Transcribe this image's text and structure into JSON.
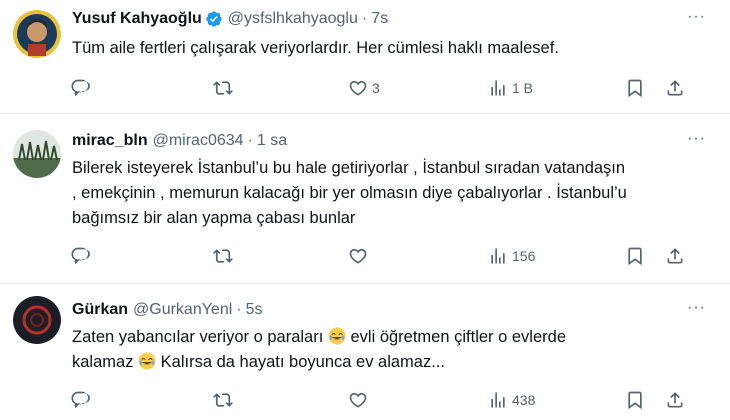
{
  "tweets": [
    {
      "name": "Yusuf Kahyaoğlu",
      "verified": true,
      "handle": "@ysfslhkahyaoglu",
      "time": "7s",
      "lines": [
        "Tüm aile fertleri çalışarak veriyorlardır. Her cümlesi haklı maalesef."
      ],
      "likes": "3",
      "views": "1 B"
    },
    {
      "name": "mirac_bln",
      "verified": false,
      "handle": "@mirac0634",
      "time": "1 sa",
      "lines": [
        "Bilerek isteyerek İstanbul’u bu hale getiriyorlar , İstanbul sıradan vatandaşın",
        ", emekçinin , memurun kalacağı bir yer olmasın diye çabalıyorlar . İstanbul’u",
        "bağımsız bir alan yapma çabası bunlar"
      ],
      "likes": "",
      "views": "156"
    },
    {
      "name": "Gürkan",
      "verified": false,
      "handle": "@GurkanYenl",
      "time": "5s",
      "line1_a": "Zaten yabancılar veriyor o paraları",
      "line1_b": "evli öğretmen çiftler o evlerde",
      "line2_a": "kalamaz",
      "line2_b": "Kalırsa da hayatı boyunca ev alamaz...",
      "emoji": "face-with-tears-of-joy",
      "likes": "",
      "views": "438"
    }
  ],
  "more_label": "···",
  "separator": "·",
  "colors": {
    "accent": "#1d9bf0",
    "muted": "#536471",
    "text": "#0f1419"
  }
}
